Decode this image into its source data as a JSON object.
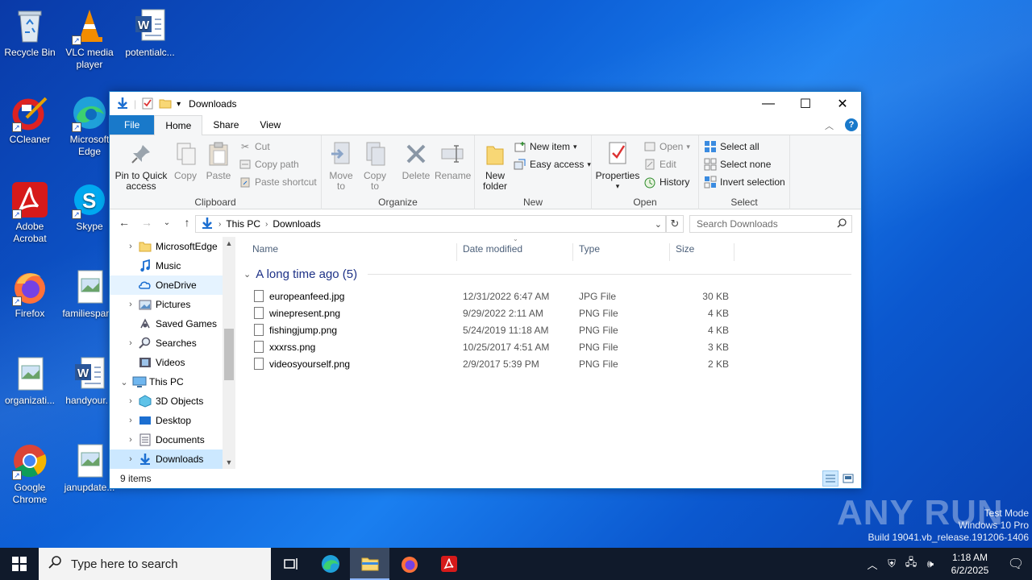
{
  "desktop": {
    "icons": [
      {
        "label": "Recycle Bin"
      },
      {
        "label": "VLC media player"
      },
      {
        "label": "potentialc..."
      },
      {
        "label": "CCleaner"
      },
      {
        "label": "Microsoft Edge"
      },
      {
        "label": "Adobe Acrobat"
      },
      {
        "label": "Skype"
      },
      {
        "label": "Firefox"
      },
      {
        "label": "familiespar..."
      },
      {
        "label": "organizati..."
      },
      {
        "label": "handyour..."
      },
      {
        "label": "Google Chrome"
      },
      {
        "label": "janupdate..."
      }
    ]
  },
  "window": {
    "title": "Downloads",
    "tabs": [
      "File",
      "Home",
      "Share",
      "View"
    ],
    "ribbon": {
      "clipboard": {
        "pin": "Pin to Quick access",
        "copy": "Copy",
        "paste": "Paste",
        "cut": "Cut",
        "copy_path": "Copy path",
        "paste_shortcut": "Paste shortcut",
        "label": "Clipboard"
      },
      "organize": {
        "move_to": "Move to",
        "copy_to": "Copy to",
        "delete": "Delete",
        "rename": "Rename",
        "label": "Organize"
      },
      "new": {
        "new_folder": "New folder",
        "new_item": "New item",
        "easy_access": "Easy access",
        "label": "New"
      },
      "open": {
        "properties": "Properties",
        "open": "Open",
        "edit": "Edit",
        "history": "History",
        "label": "Open"
      },
      "select": {
        "select_all": "Select all",
        "select_none": "Select none",
        "invert": "Invert selection",
        "label": "Select"
      }
    },
    "address": {
      "crumbs": [
        "This PC",
        "Downloads"
      ]
    },
    "search": {
      "placeholder": "Search Downloads"
    },
    "nav": [
      {
        "label": "MicrosoftEdge"
      },
      {
        "label": "Music"
      },
      {
        "label": "OneDrive"
      },
      {
        "label": "Pictures"
      },
      {
        "label": "Saved Games"
      },
      {
        "label": "Searches"
      },
      {
        "label": "Videos"
      },
      {
        "label": "This PC"
      },
      {
        "label": "3D Objects"
      },
      {
        "label": "Desktop"
      },
      {
        "label": "Documents"
      },
      {
        "label": "Downloads"
      }
    ],
    "columns": {
      "name": "Name",
      "date": "Date modified",
      "type": "Type",
      "size": "Size"
    },
    "group_header": "A long time ago (5)",
    "files": [
      {
        "name": "europeanfeed.jpg",
        "date": "12/31/2022 6:47 AM",
        "type": "JPG File",
        "size": "30 KB"
      },
      {
        "name": "winepresent.png",
        "date": "9/29/2022 2:11 AM",
        "type": "PNG File",
        "size": "4 KB"
      },
      {
        "name": "fishingjump.png",
        "date": "5/24/2019 11:18 AM",
        "type": "PNG File",
        "size": "4 KB"
      },
      {
        "name": "xxxrss.png",
        "date": "10/25/2017 4:51 AM",
        "type": "PNG File",
        "size": "3 KB"
      },
      {
        "name": "videosyourself.png",
        "date": "2/9/2017 5:39 PM",
        "type": "PNG File",
        "size": "2 KB"
      }
    ],
    "status": "9 items"
  },
  "taskbar": {
    "search_placeholder": "Type here to search",
    "time": "1:18 AM",
    "date": "6/2/2025"
  },
  "watermark": {
    "brand": "ANY RUN",
    "line1": "Test Mode",
    "line2": "Windows 10 Pro",
    "line3": "Build 19041.vb_release.191206-1406"
  }
}
